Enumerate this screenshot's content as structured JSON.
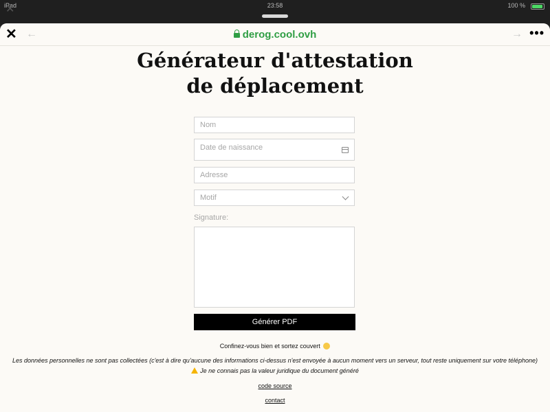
{
  "status_bar": {
    "device": "iPad",
    "time": "23:58",
    "battery": "100 %"
  },
  "browser": {
    "url": "derog.cool.ovh"
  },
  "page": {
    "title_line1": "Générateur d'attestation",
    "title_line2": "de déplacement"
  },
  "form": {
    "name_placeholder": "Nom",
    "birthdate_placeholder": "Date de naissance",
    "address_placeholder": "Adresse",
    "reason_placeholder": "Motif",
    "signature_label": "Signature:",
    "generate_label": "Générer PDF"
  },
  "footer": {
    "confine_text": "Confinez-vous bien et sortez couvert",
    "privacy_text": "Les données personnelles ne sont pas collectées (c'est à dire qu'aucune des informations ci-dessus n'est envoyée à aucun moment vers un serveur, tout reste uniquement sur votre téléphone)",
    "warning_text": "Je ne connais pas la valeur juridique du document généré",
    "source_link": "code source",
    "contact_link": "contact"
  },
  "colors": {
    "url_green": "#2f9e44",
    "page_background": "#fcfaf6",
    "button_black": "#000000"
  }
}
